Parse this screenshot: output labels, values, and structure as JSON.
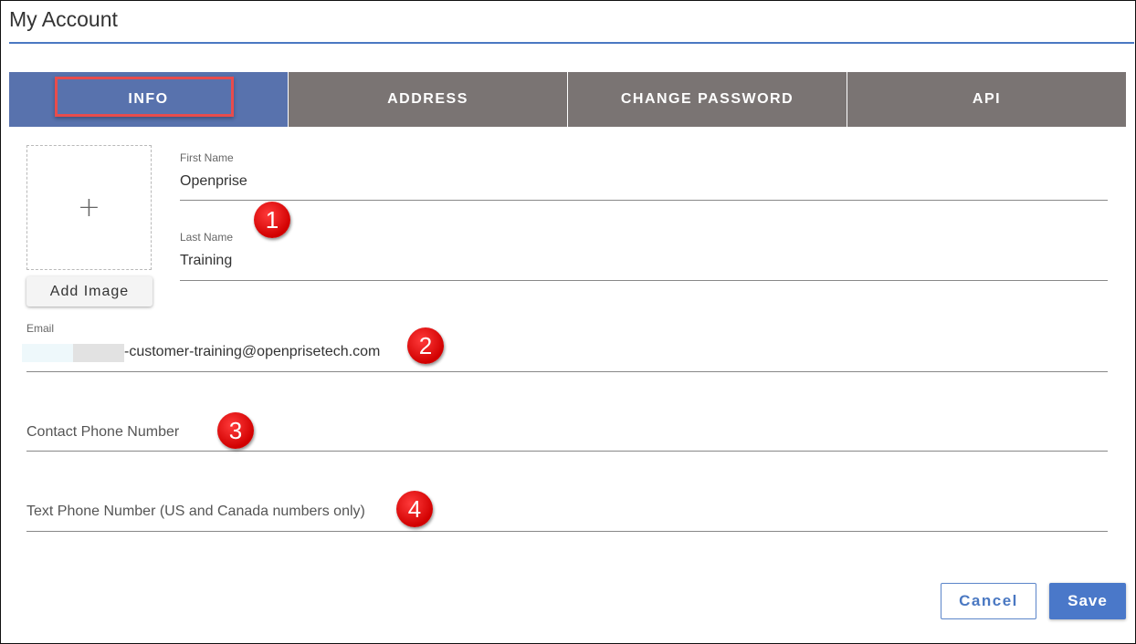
{
  "page": {
    "title": "My Account"
  },
  "tabs": [
    {
      "label": "INFO",
      "active": true
    },
    {
      "label": "ADDRESS",
      "active": false
    },
    {
      "label": "CHANGE PASSWORD",
      "active": false
    },
    {
      "label": "API",
      "active": false
    }
  ],
  "image": {
    "plus": "+",
    "add_label": "Add Image"
  },
  "fields": {
    "first_name": {
      "label": "First Name",
      "value": "Openprise"
    },
    "last_name": {
      "label": "Last Name",
      "value": "Training"
    },
    "email": {
      "label": "Email",
      "value": "-customer-training@openprisetech.com"
    },
    "contact_phone": {
      "placeholder": "Contact Phone Number"
    },
    "text_phone": {
      "placeholder": "Text Phone Number (US and Canada numbers only)"
    }
  },
  "callouts": [
    "1",
    "2",
    "3",
    "4"
  ],
  "buttons": {
    "cancel": "Cancel",
    "save": "Save"
  },
  "colors": {
    "accent": "#4a78c2",
    "tab_active": "#5872ad",
    "tab_inactive": "#7a7473",
    "highlight": "#e84c4c",
    "callout": "#d10000"
  }
}
